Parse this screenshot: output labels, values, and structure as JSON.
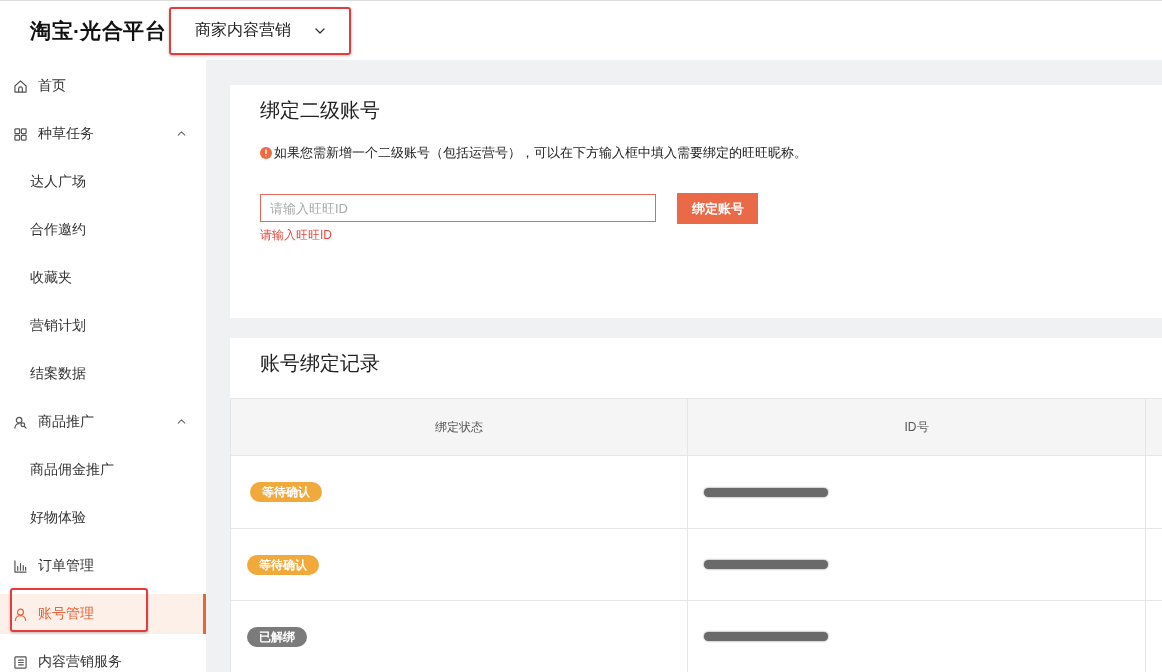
{
  "header": {
    "logo": "淘宝·光合平台",
    "switcher": {
      "label": "商家内容营销",
      "highlighted": true
    }
  },
  "sidebar": {
    "items": [
      {
        "label": "首页",
        "selected": false,
        "highlighted": false
      },
      {
        "label": "种草任务",
        "selected": false,
        "highlighted": false,
        "expanded": true,
        "children": [
          {
            "label": "达人广场",
            "selected": false
          },
          {
            "label": "合作邀约",
            "selected": false
          },
          {
            "label": "收藏夹",
            "selected": false
          },
          {
            "label": "营销计划",
            "selected": false
          },
          {
            "label": "结案数据",
            "selected": false
          }
        ]
      },
      {
        "label": "商品推广",
        "selected": false,
        "highlighted": false,
        "expanded": true,
        "children": [
          {
            "label": "商品佣金推广",
            "selected": false
          },
          {
            "label": "好物体验",
            "selected": false
          }
        ]
      },
      {
        "label": "订单管理",
        "selected": false,
        "highlighted": false
      },
      {
        "label": "账号管理",
        "selected": true,
        "highlighted": true
      },
      {
        "label": "内容营销服务",
        "selected": false,
        "highlighted": false
      }
    ]
  },
  "bind_card": {
    "title": "绑定二级账号",
    "notice": "如果您需新增一个二级账号（包括运营号），可以在下方输入框中填入需要绑定的旺旺昵称。",
    "input": {
      "placeholder": "请输入旺旺ID",
      "invalid": true
    },
    "button": "绑定账号",
    "error": "请输入旺旺ID"
  },
  "records_card": {
    "title": "账号绑定记录",
    "table": {
      "columns": [
        "绑定状态",
        "ID号"
      ],
      "rows": [
        {
          "status": "等待确认",
          "color": "#f2a93b"
        },
        {
          "status": "等待确认",
          "color": "#f2a93b"
        },
        {
          "status": "已解绑",
          "color": "#7b7b7b"
        }
      ]
    }
  }
}
